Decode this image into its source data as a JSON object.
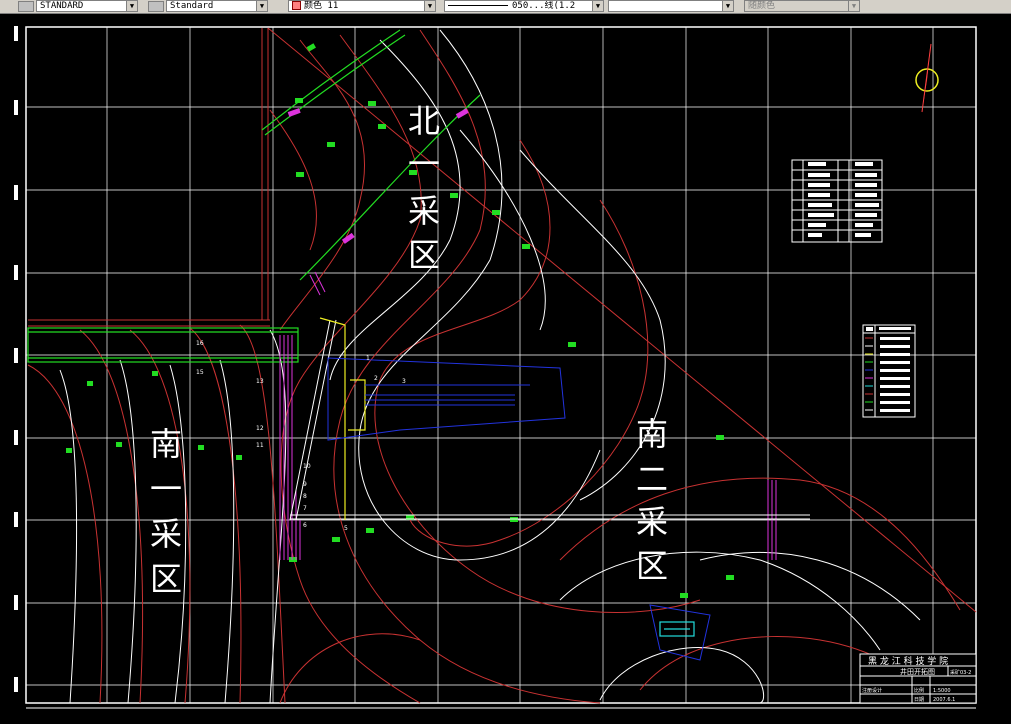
{
  "toolbar": {
    "style_dropdown": "STANDARD",
    "dimstyle_dropdown": "Standard",
    "color_dropdown": "颜色 11",
    "linetype_dropdown": "050...线(1.2",
    "lineweight_dropdown": "",
    "plotstyle_dropdown": "随颜色"
  },
  "drawing": {
    "zone_labels": [
      "北",
      "一",
      "采",
      "区",
      "南",
      "一",
      "采",
      "区",
      "南",
      "二",
      "采",
      "区"
    ],
    "line_numbers": [
      "16",
      "15",
      "13",
      "12",
      "11",
      "10",
      "9",
      "8",
      "7",
      "6",
      "5",
      "1",
      "2",
      "3"
    ],
    "title_block": {
      "org": "黑 龙 江 科 技 学 院",
      "title": "井田开拓图",
      "drawing_no": "采矿03-2",
      "scale_label": "比例",
      "scale": "1:5000",
      "date_label": "日期",
      "date": "2007.6.1",
      "designer_label": "注册设计"
    }
  },
  "colors": {
    "background": "#000000",
    "grid": "#ffffff",
    "contour_red": "#c83232",
    "contour_white": "#ffffff",
    "green": "#22dd22",
    "magenta": "#dd33dd",
    "blue": "#2222cc",
    "yellow": "#eeee22",
    "cyan": "#22dddd"
  }
}
